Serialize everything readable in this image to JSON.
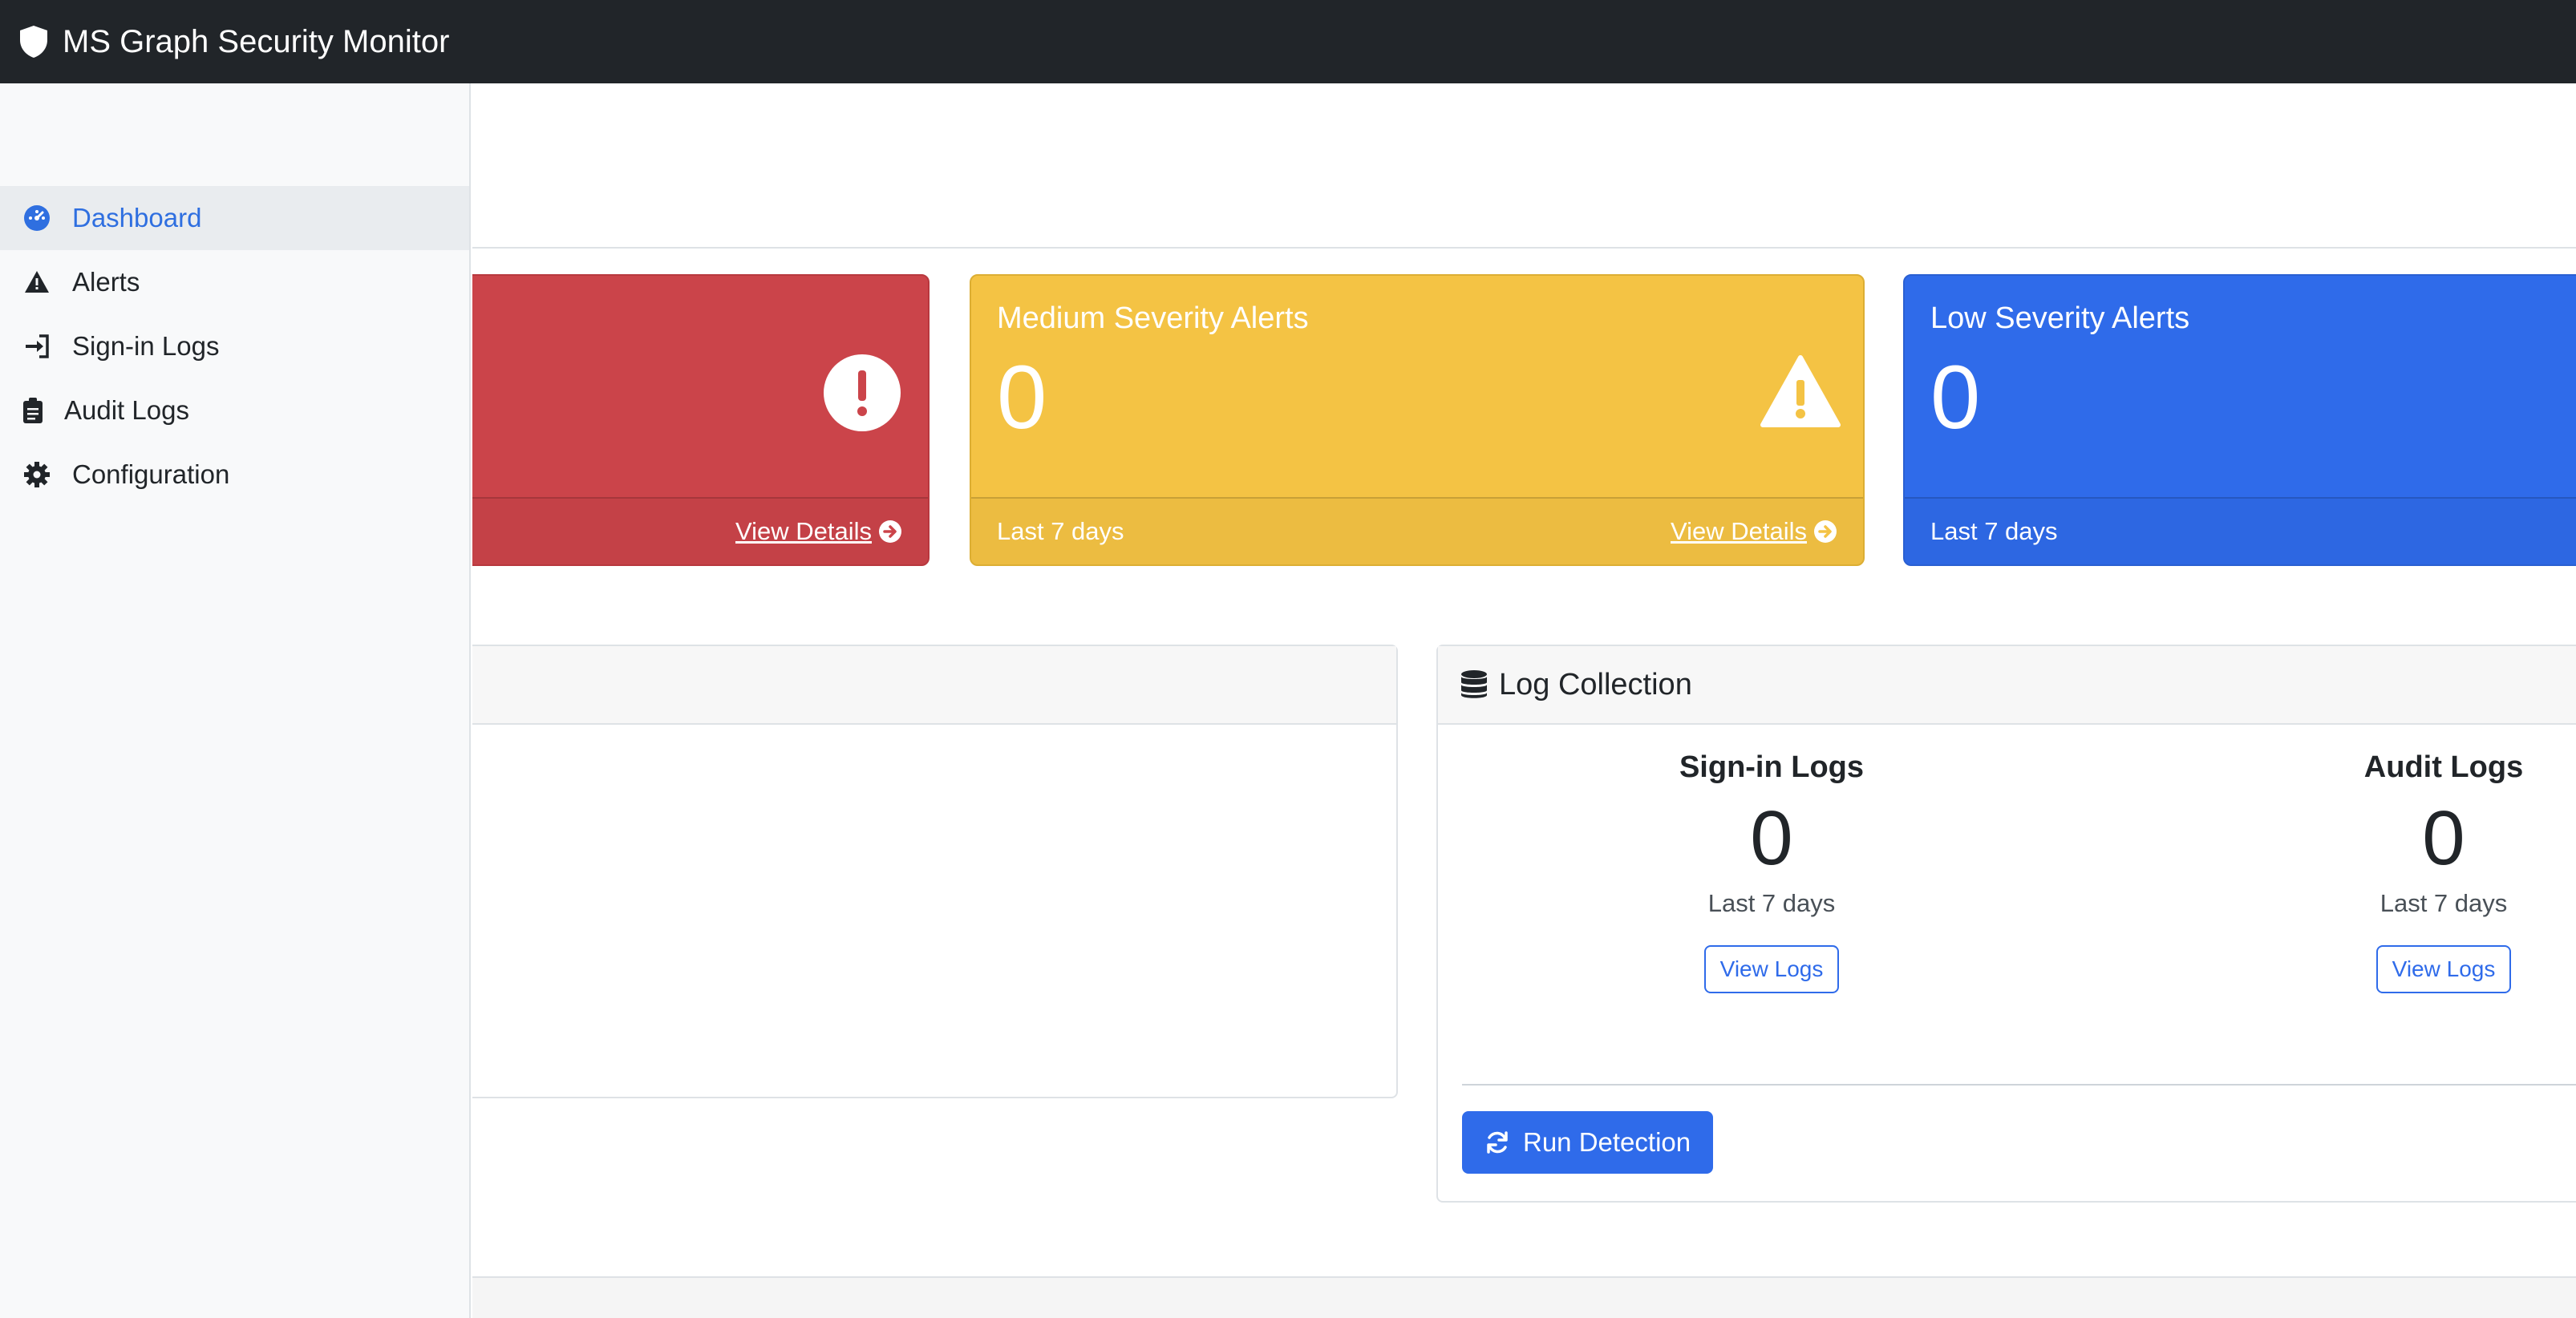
{
  "app": {
    "title": "MS Graph Security Monitor",
    "icon": "shield-icon"
  },
  "sidebar": {
    "items": [
      {
        "label": "Dashboard",
        "icon": "dashboard-gauge-icon",
        "active": true
      },
      {
        "label": "Alerts",
        "icon": "warning-triangle-icon",
        "active": false
      },
      {
        "label": "Sign-in Logs",
        "icon": "sign-in-icon",
        "active": false
      },
      {
        "label": "Audit Logs",
        "icon": "clipboard-icon",
        "active": false
      },
      {
        "label": "Configuration",
        "icon": "gear-icon",
        "active": false
      }
    ]
  },
  "cards": {
    "high": {
      "view_details": "View Details",
      "color": "#cb444a",
      "icon": "exclamation-circle-icon"
    },
    "medium": {
      "title": "Medium Severity Alerts",
      "value": "0",
      "period": "Last 7 days",
      "view_details": "View Details",
      "color": "#f4c344",
      "icon": "warning-triangle-icon"
    },
    "low": {
      "title": "Low Severity Alerts",
      "value": "0",
      "period": "Last 7 days",
      "color": "#2f6bea"
    }
  },
  "log_collection": {
    "title": "Log Collection",
    "icon": "database-icon",
    "signin": {
      "title": "Sign-in Logs",
      "value": "0",
      "period": "Last 7 days",
      "button": "View Logs"
    },
    "audit": {
      "title": "Audit Logs",
      "value": "0",
      "period": "Last 7 days",
      "button": "View Logs"
    },
    "run_button": "Run Detection",
    "run_icon": "refresh-icon"
  }
}
